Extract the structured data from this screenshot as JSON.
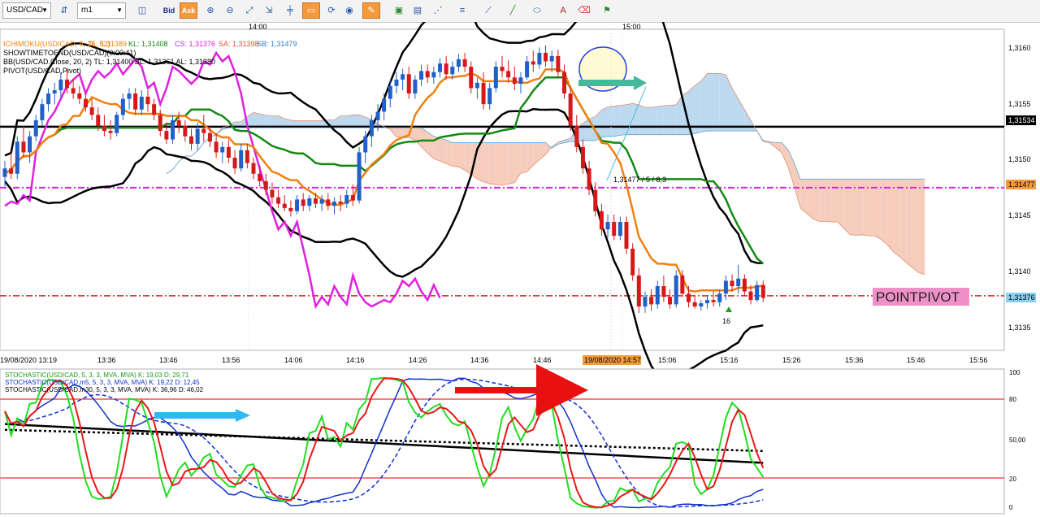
{
  "toolbar": {
    "symbol": "USD/CAD",
    "timeframe": "m1",
    "bid_label": "Bid",
    "ask_label": "Ask",
    "icons": [
      "compare-icon",
      "chart-type-icon",
      "zoom-in-icon",
      "zoom-out-icon",
      "fit-icon",
      "crosshair-icon",
      "cursor-icon",
      "refresh-icon",
      "globe-icon",
      "pencil-icon",
      "image-icon",
      "template-icon",
      "lines-icon",
      "horizontal-lines-icon",
      "tools-icon",
      "trendline-icon",
      "shapes-icon",
      "text-icon",
      "eraser-icon",
      "alert-icon"
    ]
  },
  "legend": {
    "ichimoku": "ICHIMOKU(USD/CAD, 9, 26, 52)",
    "ichi_tl": "TL: 1,31389",
    "ichi_kl": "KL: 1,31408",
    "ichi_cs": "CS: 1,31376",
    "ichi_sa": "SA: 1,31398",
    "ichi_sb": "SB: 1,31479",
    "showtime": "SHOWTIMETOEND(USD/CAD)(0:00:41)",
    "bb": "BB(USD/CAD.Close, 20, 2)  TL: 1,31400  BL: 1,31361  AL: 1,31380",
    "pivot": "PIVOT(USD/CAD,Pivot)"
  },
  "annotations": {
    "fib_label": "1,31477 / 5 / 8,3",
    "point_pivot": "POINTPIVOT",
    "marker_16": "16"
  },
  "price_axis": {
    "ticks": [
      "1,3160",
      "1,3155",
      "1,3150",
      "1,3145",
      "1,3140",
      "1,3135"
    ],
    "badge_black": "1,31534",
    "badge_orange": "1,31477",
    "badge_blue": "1,31376"
  },
  "time_axis": {
    "top_labels": [
      "14:00",
      "15:00"
    ],
    "ticks": [
      "19/08/2020 13:19",
      "13:36",
      "13:46",
      "13:56",
      "14:06",
      "14:16",
      "14:26",
      "14:36",
      "14:46",
      "15:06",
      "15:16",
      "15:26",
      "15:36",
      "15:46",
      "15:56"
    ],
    "cursor_label": "19/08/2020 14:57"
  },
  "stoch_legend": {
    "s1": "STOCHASTIC(USD/CAD, 5, 3, 3, MVA, MVA)  K: 19,03  D: 29,71",
    "s2": "STOCHASTIC(USD/CAD.m5, 5, 3, 3, MVA, MVA)  K: 19,22  D: 12,45",
    "s3": "STOCHASTIC(USD/CAD.m30, 5, 3, 3, MVA, MVA)  K: 36,96  D: 46,02"
  },
  "stoch_axis": {
    "ticks": [
      "100",
      "80",
      "50,00",
      "20",
      "0"
    ]
  },
  "colors": {
    "bull": "#2060c8",
    "bear": "#d81818",
    "tenkan": "#f08010",
    "kijun": "#128a12",
    "chikou": "#e020e0",
    "cloud_blue": "#bcd9ef",
    "cloud_red": "#f6cdbd",
    "bb": "#000000",
    "pivot_magenta": "#e020e0",
    "pivot_red": "#e02020"
  },
  "chart_data": {
    "type": "line",
    "symbol": "USD/CAD",
    "timeframe": "m1",
    "y_range": [
      1.31325,
      1.31625
    ],
    "levels": {
      "resistance_black": 1.31534,
      "pivot_magenta": 1.31477,
      "pivot_red": 1.31376
    },
    "candles": [
      [
        1.31487,
        1.31502,
        1.31478,
        1.31495
      ],
      [
        1.31495,
        1.3151,
        1.31485,
        1.3149
      ],
      [
        1.3149,
        1.31525,
        1.31485,
        1.3152
      ],
      [
        1.3152,
        1.31535,
        1.31505,
        1.3151
      ],
      [
        1.3151,
        1.3153,
        1.315,
        1.31525
      ],
      [
        1.31525,
        1.31545,
        1.3152,
        1.3154
      ],
      [
        1.3154,
        1.3156,
        1.31535,
        1.31555
      ],
      [
        1.31555,
        1.3157,
        1.31548,
        1.31565
      ],
      [
        1.31565,
        1.31575,
        1.31555,
        1.31568
      ],
      [
        1.31568,
        1.31585,
        1.3156,
        1.31578
      ],
      [
        1.31578,
        1.31588,
        1.31565,
        1.3157
      ],
      [
        1.3157,
        1.31578,
        1.3156,
        1.31565
      ],
      [
        1.31565,
        1.31572,
        1.31555,
        1.3156
      ],
      [
        1.3156,
        1.31565,
        1.31548,
        1.31552
      ],
      [
        1.31552,
        1.3156,
        1.3154,
        1.31545
      ],
      [
        1.31545,
        1.31552,
        1.3153,
        1.31535
      ],
      [
        1.31535,
        1.31545,
        1.31525,
        1.3153
      ],
      [
        1.3153,
        1.3154,
        1.31522,
        1.31528
      ],
      [
        1.31528,
        1.31548,
        1.31525,
        1.31545
      ],
      [
        1.31545,
        1.31565,
        1.3154,
        1.3156
      ],
      [
        1.3156,
        1.3157,
        1.3155,
        1.31565
      ],
      [
        1.31565,
        1.3157,
        1.31545,
        1.3155
      ],
      [
        1.3155,
        1.31568,
        1.31545,
        1.31562
      ],
      [
        1.31562,
        1.31568,
        1.31548,
        1.31555
      ],
      [
        1.31555,
        1.3156,
        1.3154,
        1.31545
      ],
      [
        1.31545,
        1.3155,
        1.31525,
        1.3153
      ],
      [
        1.3153,
        1.31538,
        1.31518,
        1.31522
      ],
      [
        1.31522,
        1.31545,
        1.31518,
        1.3154
      ],
      [
        1.3154,
        1.31548,
        1.31528,
        1.31535
      ],
      [
        1.31535,
        1.3154,
        1.3152,
        1.31525
      ],
      [
        1.31525,
        1.31532,
        1.31512,
        1.31518
      ],
      [
        1.31518,
        1.31538,
        1.31512,
        1.31532
      ],
      [
        1.31532,
        1.31545,
        1.3152,
        1.31528
      ],
      [
        1.31528,
        1.31535,
        1.31515,
        1.3152
      ],
      [
        1.3152,
        1.31528,
        1.31505,
        1.3151
      ],
      [
        1.3151,
        1.3152,
        1.315,
        1.31515
      ],
      [
        1.31515,
        1.31522,
        1.315,
        1.31505
      ],
      [
        1.31505,
        1.31512,
        1.3149,
        1.31495
      ],
      [
        1.31495,
        1.31518,
        1.31492,
        1.31512
      ],
      [
        1.31512,
        1.31518,
        1.31495,
        1.315
      ],
      [
        1.315,
        1.31505,
        1.31485,
        1.3149
      ],
      [
        1.3149,
        1.31498,
        1.31478,
        1.31483
      ],
      [
        1.31483,
        1.3149,
        1.3147,
        1.31475
      ],
      [
        1.31475,
        1.31482,
        1.31462,
        1.31468
      ],
      [
        1.31468,
        1.31475,
        1.31458,
        1.31462
      ],
      [
        1.31462,
        1.3147,
        1.31455,
        1.31458
      ],
      [
        1.31458,
        1.31465,
        1.3145,
        1.31455
      ],
      [
        1.31455,
        1.3147,
        1.31452,
        1.31466
      ],
      [
        1.31466,
        1.31472,
        1.31455,
        1.3146
      ],
      [
        1.3146,
        1.3147,
        1.31455,
        1.31467
      ],
      [
        1.31467,
        1.31472,
        1.31458,
        1.31462
      ],
      [
        1.31462,
        1.3147,
        1.31455,
        1.31466
      ],
      [
        1.31466,
        1.31472,
        1.31456,
        1.3146
      ],
      [
        1.3146,
        1.31468,
        1.31452,
        1.31464
      ],
      [
        1.31464,
        1.3147,
        1.31455,
        1.31462
      ],
      [
        1.31462,
        1.31475,
        1.31458,
        1.3147
      ],
      [
        1.3147,
        1.3148,
        1.3146,
        1.31465
      ],
      [
        1.31465,
        1.31515,
        1.31462,
        1.3151
      ],
      [
        1.3151,
        1.3153,
        1.315,
        1.31525
      ],
      [
        1.31525,
        1.31545,
        1.31515,
        1.3154
      ],
      [
        1.3154,
        1.31555,
        1.3153,
        1.31548
      ],
      [
        1.31548,
        1.31565,
        1.3154,
        1.3156
      ],
      [
        1.3156,
        1.31578,
        1.31552,
        1.31572
      ],
      [
        1.31572,
        1.31585,
        1.31565,
        1.31578
      ],
      [
        1.31578,
        1.31588,
        1.31568,
        1.31583
      ],
      [
        1.31583,
        1.3159,
        1.3156,
        1.31565
      ],
      [
        1.31565,
        1.31582,
        1.3156,
        1.31578
      ],
      [
        1.31578,
        1.31592,
        1.31572,
        1.31586
      ],
      [
        1.31586,
        1.31592,
        1.31575,
        1.3158
      ],
      [
        1.3158,
        1.3159,
        1.31574,
        1.31585
      ],
      [
        1.31585,
        1.31598,
        1.3158,
        1.31593
      ],
      [
        1.31593,
        1.316,
        1.31578,
        1.31583
      ],
      [
        1.31583,
        1.31595,
        1.31578,
        1.3159
      ],
      [
        1.3159,
        1.31602,
        1.31585,
        1.31597
      ],
      [
        1.31597,
        1.31603,
        1.31585,
        1.3159
      ],
      [
        1.3159,
        1.31595,
        1.31565,
        1.3157
      ],
      [
        1.3157,
        1.3158,
        1.3156,
        1.31575
      ],
      [
        1.31575,
        1.31585,
        1.3155,
        1.31555
      ],
      [
        1.31555,
        1.31575,
        1.3155,
        1.3157
      ],
      [
        1.3157,
        1.31595,
        1.31566,
        1.3159
      ],
      [
        1.3159,
        1.316,
        1.3158,
        1.31586
      ],
      [
        1.31586,
        1.31596,
        1.31575,
        1.3158
      ],
      [
        1.3158,
        1.3159,
        1.31568,
        1.31574
      ],
      [
        1.31574,
        1.31585,
        1.31565,
        1.3158
      ],
      [
        1.3158,
        1.316,
        1.31578,
        1.31595
      ],
      [
        1.31595,
        1.31605,
        1.31585,
        1.31592
      ],
      [
        1.31592,
        1.31608,
        1.31588,
        1.31603
      ],
      [
        1.31603,
        1.3161,
        1.3159,
        1.31595
      ],
      [
        1.31595,
        1.31605,
        1.31585,
        1.316
      ],
      [
        1.316,
        1.31606,
        1.3158,
        1.31585
      ],
      [
        1.31585,
        1.31592,
        1.3156,
        1.31565
      ],
      [
        1.31565,
        1.31572,
        1.3153,
        1.31535
      ],
      [
        1.31535,
        1.31545,
        1.3151,
        1.31515
      ],
      [
        1.31515,
        1.31522,
        1.3149,
        1.31495
      ],
      [
        1.31495,
        1.31502,
        1.3147,
        1.31475
      ],
      [
        1.31475,
        1.31482,
        1.3145,
        1.31455
      ],
      [
        1.31455,
        1.31462,
        1.31432,
        1.31438
      ],
      [
        1.31438,
        1.31452,
        1.3143,
        1.31445
      ],
      [
        1.31445,
        1.31452,
        1.31428,
        1.31432
      ],
      [
        1.31432,
        1.3145,
        1.31428,
        1.31445
      ],
      [
        1.31445,
        1.3145,
        1.31415,
        1.3142
      ],
      [
        1.3142,
        1.31425,
        1.3139,
        1.31395
      ],
      [
        1.31395,
        1.31402,
        1.3136,
        1.31366
      ],
      [
        1.31366,
        1.3138,
        1.3136,
        1.31375
      ],
      [
        1.31375,
        1.31382,
        1.31362,
        1.31368
      ],
      [
        1.31368,
        1.3139,
        1.31364,
        1.31385
      ],
      [
        1.31385,
        1.31395,
        1.3137,
        1.31375
      ],
      [
        1.31375,
        1.31382,
        1.31364,
        1.31368
      ],
      [
        1.31368,
        1.314,
        1.31365,
        1.31395
      ],
      [
        1.31395,
        1.314,
        1.31375,
        1.31378
      ],
      [
        1.31378,
        1.31385,
        1.31365,
        1.3137
      ],
      [
        1.3137,
        1.31376,
        1.31364,
        1.31366
      ],
      [
        1.31366,
        1.31372,
        1.31362,
        1.31369
      ],
      [
        1.31369,
        1.31376,
        1.31364,
        1.31372
      ],
      [
        1.31372,
        1.3138,
        1.31366,
        1.3137
      ],
      [
        1.3137,
        1.31382,
        1.31366,
        1.31378
      ],
      [
        1.31378,
        1.31395,
        1.31372,
        1.3139
      ],
      [
        1.3139,
        1.31396,
        1.3138,
        1.31385
      ],
      [
        1.31385,
        1.31405,
        1.31378,
        1.31392
      ],
      [
        1.31392,
        1.31396,
        1.31376,
        1.3138
      ],
      [
        1.3138,
        1.31386,
        1.31368,
        1.31372
      ],
      [
        1.31372,
        1.3139,
        1.3137,
        1.31386
      ],
      [
        1.31386,
        1.3139,
        1.3137,
        1.31374
      ]
    ]
  }
}
